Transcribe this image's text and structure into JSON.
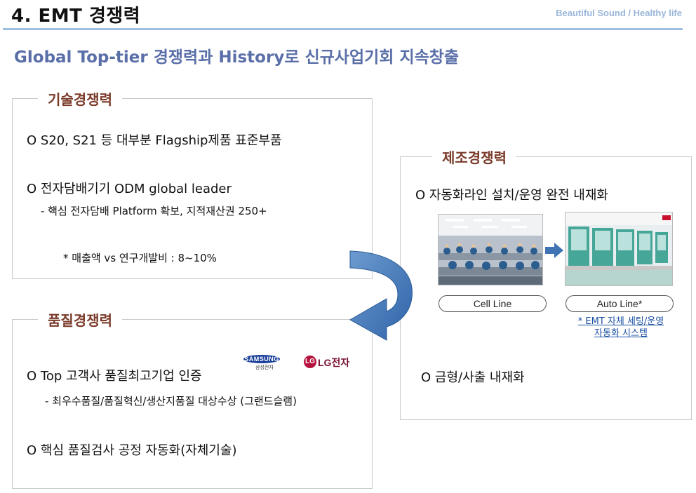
{
  "header": {
    "title": "4. EMT 경쟁력",
    "tagline": "Beautiful Sound / Healthy life",
    "subtitle": "Global Top-tier 경쟁력과 History로 신규사업기회 지속창출"
  },
  "tech": {
    "title": "기술경쟁력",
    "item1": "O S20, S21 등 대부분 Flagship제품 표준부품",
    "item2": "O 전자담배기기 ODM global leader",
    "item2_sub": "- 핵심 전자담배 Platform 확보,  지적재산권 250+",
    "note": "*  매출액 vs 연구개발비 : 8~10%"
  },
  "quality": {
    "title": "품질경쟁력",
    "item1": "O Top 고객사 품질최고기업 인증",
    "item1_sub": "- 최우수품질/품질혁신/생산지품질 대상수상 (그랜드슬램)",
    "item2": "O 핵심 품질검사 공정 자동화(자체기술)",
    "logos": {
      "samsung": "SAMSUNG",
      "samsung_sub": "삼성전자",
      "lg_mark": "LG",
      "lg_text": "LG전자"
    }
  },
  "mfg": {
    "title": "제조경쟁력",
    "item1": "O 자동화라인 설치/운영 완전 내재화",
    "cell_label": "Cell Line",
    "auto_label": "Auto Line*",
    "auto_note_1": "* EMT 자체 세팅/운영",
    "auto_note_2": "자동화 시스템",
    "item2": "O 금형/사출 내재화"
  },
  "colors": {
    "accent_rule": "#9fbfe0",
    "subtitle": "#5a6fa8",
    "box_title": "#7a3b2a",
    "arrow": "#3f73b3"
  }
}
